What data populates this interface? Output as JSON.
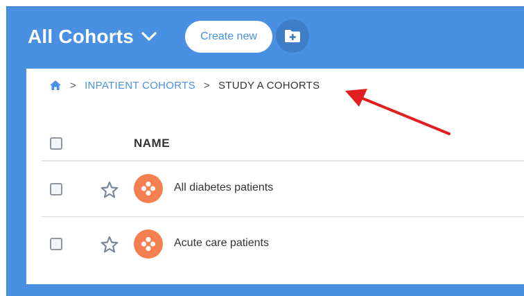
{
  "header": {
    "title": "All Cohorts",
    "create_label": "Create new"
  },
  "breadcrumb": {
    "items": [
      "INPATIENT COHORTS",
      "STUDY A COHORTS"
    ]
  },
  "table": {
    "column_name": "NAME",
    "rows": [
      {
        "label": "All diabetes patients"
      },
      {
        "label": "Acute care patients"
      }
    ]
  },
  "icons": {
    "title_dropdown": "chevron-down-icon",
    "new_folder": "folder-plus-icon",
    "home": "home-icon",
    "favorite": "star-icon",
    "cohort": "cohort-icon"
  },
  "colors": {
    "brand_blue": "#4a90e2",
    "cohort_orange": "#f5804f",
    "annotation_red": "#e02020"
  }
}
